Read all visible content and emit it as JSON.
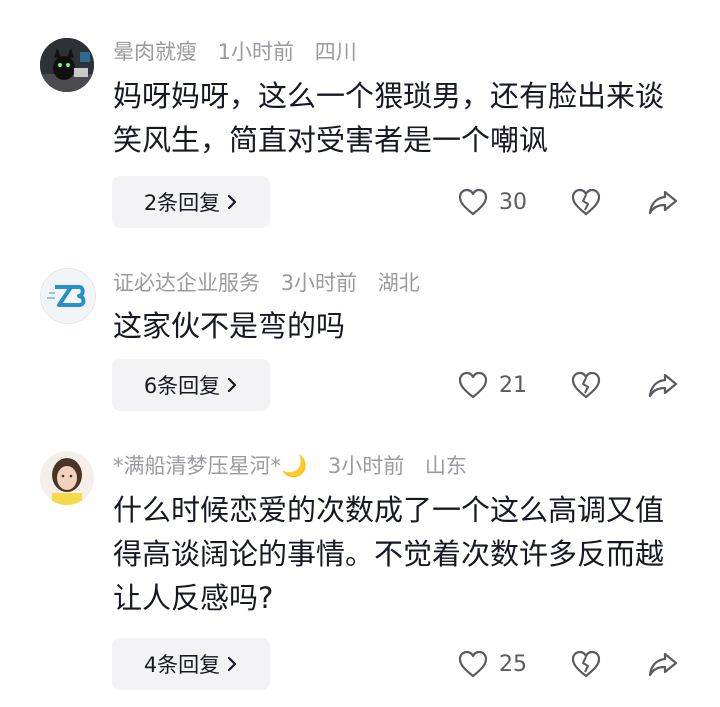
{
  "comments": [
    {
      "username": "晕肉就瘦",
      "time": "1小时前",
      "location": "四川",
      "text": "妈呀妈呀，这么一个猥琐男，还有脸出来谈笑风生，简直对受害者是一个嘲讽",
      "reply_label": "2条回复",
      "likes": "30",
      "avatar_icon": "black-cat-avatar-icon"
    },
    {
      "username": "证必达企业服务",
      "time": "3小时前",
      "location": "湖北",
      "text": "这家伙不是弯的吗",
      "reply_label": "6条回复",
      "likes": "21",
      "avatar_icon": "zb-logo-avatar-icon"
    },
    {
      "username": "*满船清梦压星河*🌙",
      "time": "3小时前",
      "location": "山东",
      "text": "什么时候恋爱的次数成了一个这么高调又值得高谈阔论的事情。不觉着次数许多反而越让人反感吗?",
      "reply_label": "4条回复",
      "likes": "25",
      "avatar_icon": "girl-photo-avatar-icon"
    }
  ],
  "icons": {
    "like": "heart-outline-icon",
    "dislike": "broken-heart-icon",
    "share": "share-arrow-icon",
    "chevron": "chevron-right-icon"
  },
  "colors": {
    "meta_gray": "#9a9aa0",
    "text_dark": "#161823",
    "button_bg": "#f3f3f5"
  }
}
